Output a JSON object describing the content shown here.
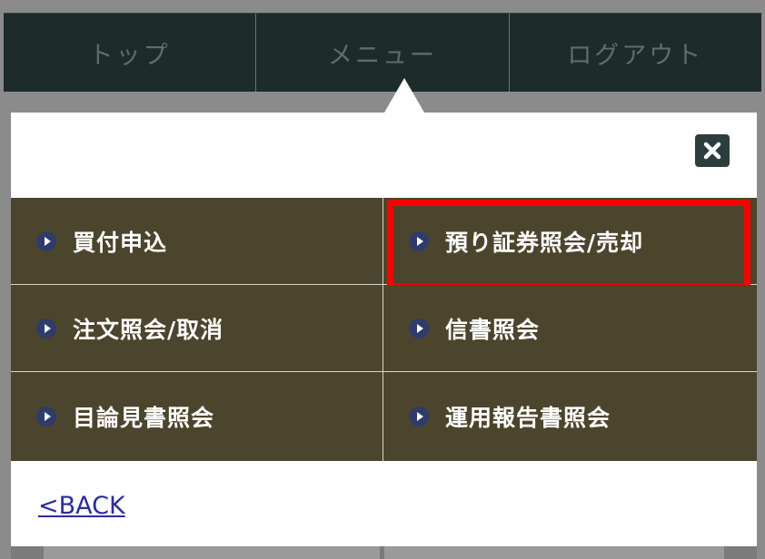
{
  "topnav": {
    "tabs": [
      {
        "label": "トップ"
      },
      {
        "label": "メニュー"
      },
      {
        "label": "ログアウト"
      }
    ]
  },
  "panel": {
    "close_icon": "close-icon",
    "menu_items": [
      {
        "label": "買付申込"
      },
      {
        "label": "預り証券照会/売却",
        "highlighted": true
      },
      {
        "label": "注文照会/取消"
      },
      {
        "label": "信書照会"
      },
      {
        "label": "目論見書照会"
      },
      {
        "label": "運用報告書照会"
      }
    ],
    "back_label": "<BACK"
  },
  "colors": {
    "nav_background": "#1e2b2b",
    "menu_cell": "#4c452d",
    "bullet": "#2f3b6b",
    "highlight_border": "#ff0000",
    "back_link": "#2a2aa8"
  }
}
